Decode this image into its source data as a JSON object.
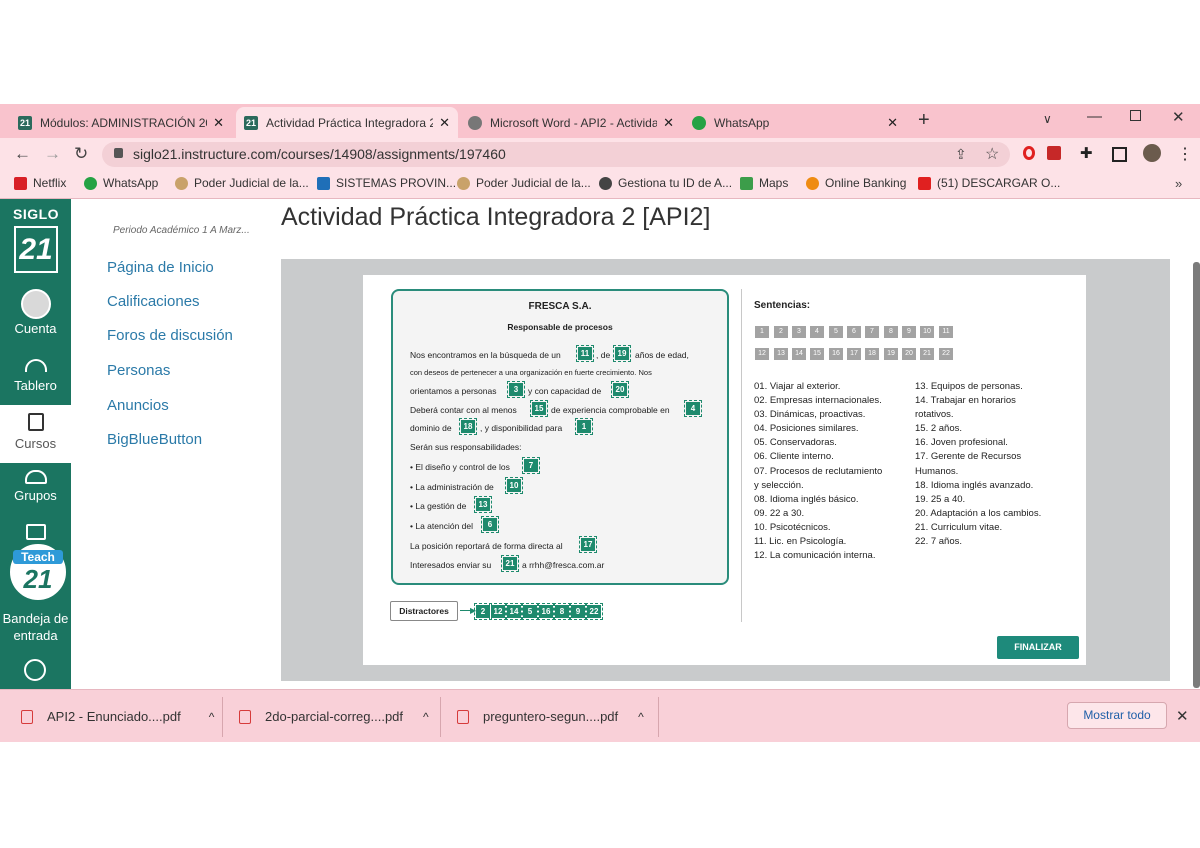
{
  "browser": {
    "tabs": [
      {
        "label": "Módulos: ADMINISTRACIÓN 20-",
        "icon": "canvas-icon"
      },
      {
        "label": "Actividad Práctica Integradora 2",
        "icon": "canvas-icon"
      },
      {
        "label": "Microsoft Word - API2 - Activida",
        "icon": "globe-icon"
      },
      {
        "label": "WhatsApp",
        "icon": "whatsapp-icon"
      }
    ],
    "close_glyph": "✕",
    "new_tab": "+",
    "url": "siglo21.instructure.com/courses/14908/assignments/197460",
    "bookmarks": [
      "Netflix",
      "WhatsApp",
      "Poder Judicial de la...",
      "SISTEMAS PROVIN...",
      "Poder Judicial de la...",
      "Gestiona tu ID de A...",
      "Maps",
      "Online Banking",
      "(51) DESCARGAR O..."
    ],
    "more_bookmarks": "»"
  },
  "sidebar": {
    "logo_top": "SIGLO",
    "logo_num": "21",
    "items": [
      {
        "label": "Cuenta"
      },
      {
        "label": "Tablero"
      },
      {
        "label": "Cursos"
      },
      {
        "label": "Grupos"
      },
      {
        "label": "Bandeja de entrada"
      }
    ],
    "teach_badge": "Teach",
    "teach_num": "21"
  },
  "course_nav": {
    "period": "Periodo Académico 1 A Marz...",
    "items": [
      "Página de Inicio",
      "Calificaciones",
      "Foros de discusión",
      "Personas",
      "Anuncios",
      "BigBlueButton"
    ]
  },
  "page": {
    "title": "Actividad Práctica Integradora 2 [API2]"
  },
  "activity": {
    "company": "FRESCA S.A.",
    "role": "Responsable de procesos",
    "lines": {
      "l1a": "Nos encontramos en la búsqueda de un",
      "l1b": ", de",
      "l1c": "años de edad,",
      "l2": "con deseos de pertenecer a una organización en fuerte crecimiento. Nos",
      "l3a": "orientamos a personas",
      "l3b": "y con capacidad de",
      "l4a": "Deberá contar con al menos",
      "l4b": "de experiencia comprobable en",
      "l5a": "dominio de",
      "l5b": ", y disponibilidad para",
      "l6": "Serán sus responsabilidades:",
      "l7": "• El diseño y control de los",
      "l8": "• La administración de",
      "l9": "• La gestión de",
      "l10": "• La atención del",
      "l11": "La posición reportará de forma directa al",
      "l12a": "Interesados enviar su",
      "l12b": "a rrhh@fresca.com.ar"
    },
    "chips": {
      "c1": "11",
      "c2": "19",
      "c3": "3",
      "c4": "20",
      "c5": "15",
      "c6": "4",
      "c7": "18",
      "c8": "1",
      "c9": "7",
      "c10": "10",
      "c11": "13",
      "c12": "6",
      "c13": "17",
      "c14": "21"
    },
    "distractores_label": "Distractores",
    "distractores": [
      "2",
      "12",
      "14",
      "5",
      "16",
      "8",
      "9",
      "22"
    ],
    "sentences_title": "Sentencias:",
    "grid_row1": [
      "1",
      "2",
      "3",
      "4",
      "5",
      "6",
      "7",
      "8",
      "9",
      "10",
      "11"
    ],
    "grid_row2": [
      "12",
      "13",
      "14",
      "15",
      "16",
      "17",
      "18",
      "19",
      "20",
      "21",
      "22"
    ],
    "sentences_left": [
      "01. Viajar al exterior.",
      "02. Empresas internacionales.",
      "03. Dinámicas, proactivas.",
      "04. Posiciones similares.",
      "05. Conservadoras.",
      "06. Cliente interno.",
      "07. Procesos de reclutamiento",
      "y selección.",
      "08. Idioma inglés básico.",
      "09. 22 a 30.",
      "10. Psicotécnicos.",
      "11. Lic. en Psicología.",
      "12. La comunicación interna."
    ],
    "sentences_right": [
      "13. Equipos de personas.",
      "14. Trabajar en horarios",
      "rotativos.",
      "15. 2 años.",
      "16. Joven profesional.",
      "17. Gerente de Recursos",
      "Humanos.",
      "18. Idioma inglés avanzado.",
      "19. 25 a 40.",
      "20. Adaptación a los cambios.",
      "21. Curriculum vitae.",
      "22. 7 años."
    ],
    "finish_button": "FINALIZAR"
  },
  "downloads": {
    "items": [
      "API2 - Enunciado....pdf",
      "2do-parcial-correg....pdf",
      "preguntero-segun....pdf"
    ],
    "show_all": "Mostrar todo"
  },
  "colors": {
    "tab_bar": "#f9c3cd",
    "canvas_green": "#1b7561",
    "chip_green": "#1e8a6d",
    "link_blue": "#2b7aa8"
  }
}
